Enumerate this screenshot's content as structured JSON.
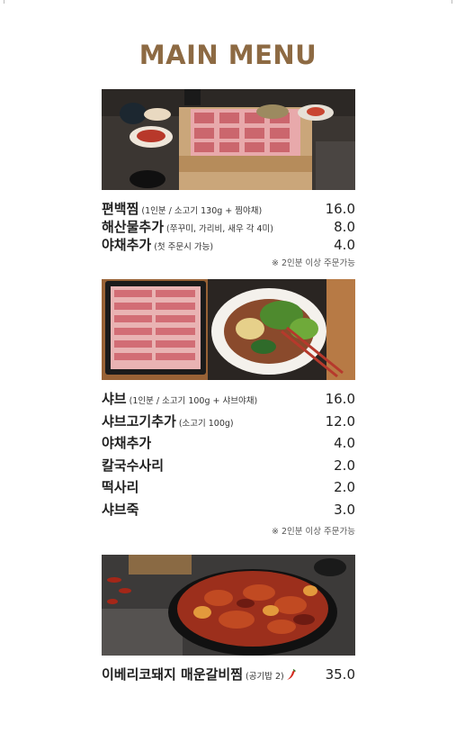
{
  "menu": {
    "title": "MAIN MENU"
  },
  "sections": [
    {
      "photo_icon": "steamed-beef-tray-photo",
      "items": [
        {
          "name": "편백찜",
          "note": "(1인분 / 소고기 130g + 찜야채)",
          "price": "16.0"
        },
        {
          "name": "해산물추가",
          "note": "(쭈꾸미, 가리비, 새우 각 4미)",
          "price": "8.0"
        },
        {
          "name": "야채추가",
          "note": "(첫 주문시 가능)",
          "price": "4.0"
        }
      ],
      "footnote": "※ 2인분 이상 주문가능"
    },
    {
      "photo_icon": "shabu-shabu-photo",
      "items": [
        {
          "name": "샤브",
          "note": "(1인분 / 소고기 100g + 샤브야채)",
          "price": "16.0"
        },
        {
          "name": "샤브고기추가",
          "note": "(소고기 100g)",
          "price": "12.0"
        },
        {
          "name": "야채추가",
          "note": "",
          "price": "4.0"
        },
        {
          "name": "칼국수사리",
          "note": "",
          "price": "2.0"
        },
        {
          "name": "떡사리",
          "note": "",
          "price": "2.0"
        },
        {
          "name": "샤브죽",
          "note": "",
          "price": "3.0"
        }
      ],
      "footnote": "※ 2인분 이상 주문가능"
    },
    {
      "photo_icon": "spicy-braised-ribs-photo",
      "items": [
        {
          "name": "이베리코돼지 매운갈비찜",
          "note": "(공기밥 2)",
          "price": "35.0",
          "icon": "chili-pepper-icon"
        }
      ],
      "footnote": ""
    }
  ],
  "colors": {
    "title": "#8d6a43",
    "text": "#1f1f1f",
    "chili": "#d42a1e"
  }
}
